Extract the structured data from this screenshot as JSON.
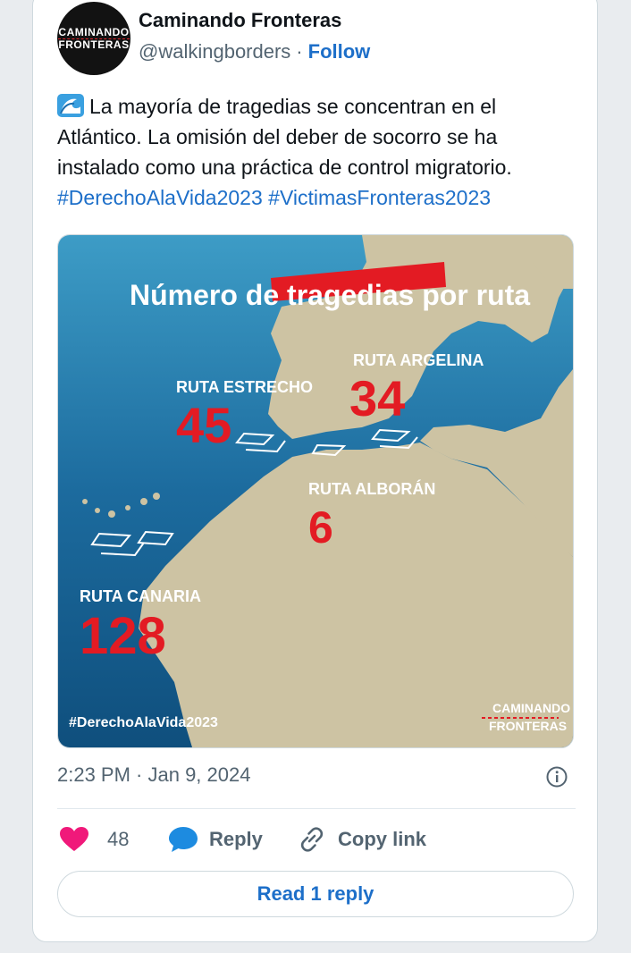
{
  "author": {
    "name": "Caminando Fronteras",
    "handle": "@walkingborders",
    "separator": "·",
    "follow_label": "Follow",
    "avatar_logo_line1": "CAMINANDO",
    "avatar_logo_line2": "FRONTERAS"
  },
  "tweet": {
    "emoji_icon": "water-wave-icon",
    "text": "La mayoría de tragedias se concentran en el Atlántico. La omisión del deber de socorro se ha instalado como una práctica de control migratorio.",
    "hashtags": [
      "#DerechoAlaVida2023",
      "#VictimasFronteras2023"
    ]
  },
  "media": {
    "title": "Número de tragedias por ruta",
    "routes": [
      {
        "label": "RUTA ESTRECHO",
        "value": "45"
      },
      {
        "label": "RUTA ARGELINA",
        "value": "34"
      },
      {
        "label": "RUTA ALBORÁN",
        "value": "6"
      },
      {
        "label": "RUTA CANARIA",
        "value": "128"
      }
    ],
    "hashtag": "#DerechoAlaVida2023",
    "logo_line1": "CAMINANDO",
    "logo_line2": "FRONTERAS",
    "colors": {
      "sea": "#1a6fa0",
      "land": "#cfc5a5",
      "accent": "#e31b23"
    }
  },
  "meta": {
    "timestamp": "2:23 PM · Jan 9, 2024"
  },
  "actions": {
    "like_count": "48",
    "reply_label": "Reply",
    "copy_link_label": "Copy link"
  },
  "read_reply_label": "Read 1 reply"
}
